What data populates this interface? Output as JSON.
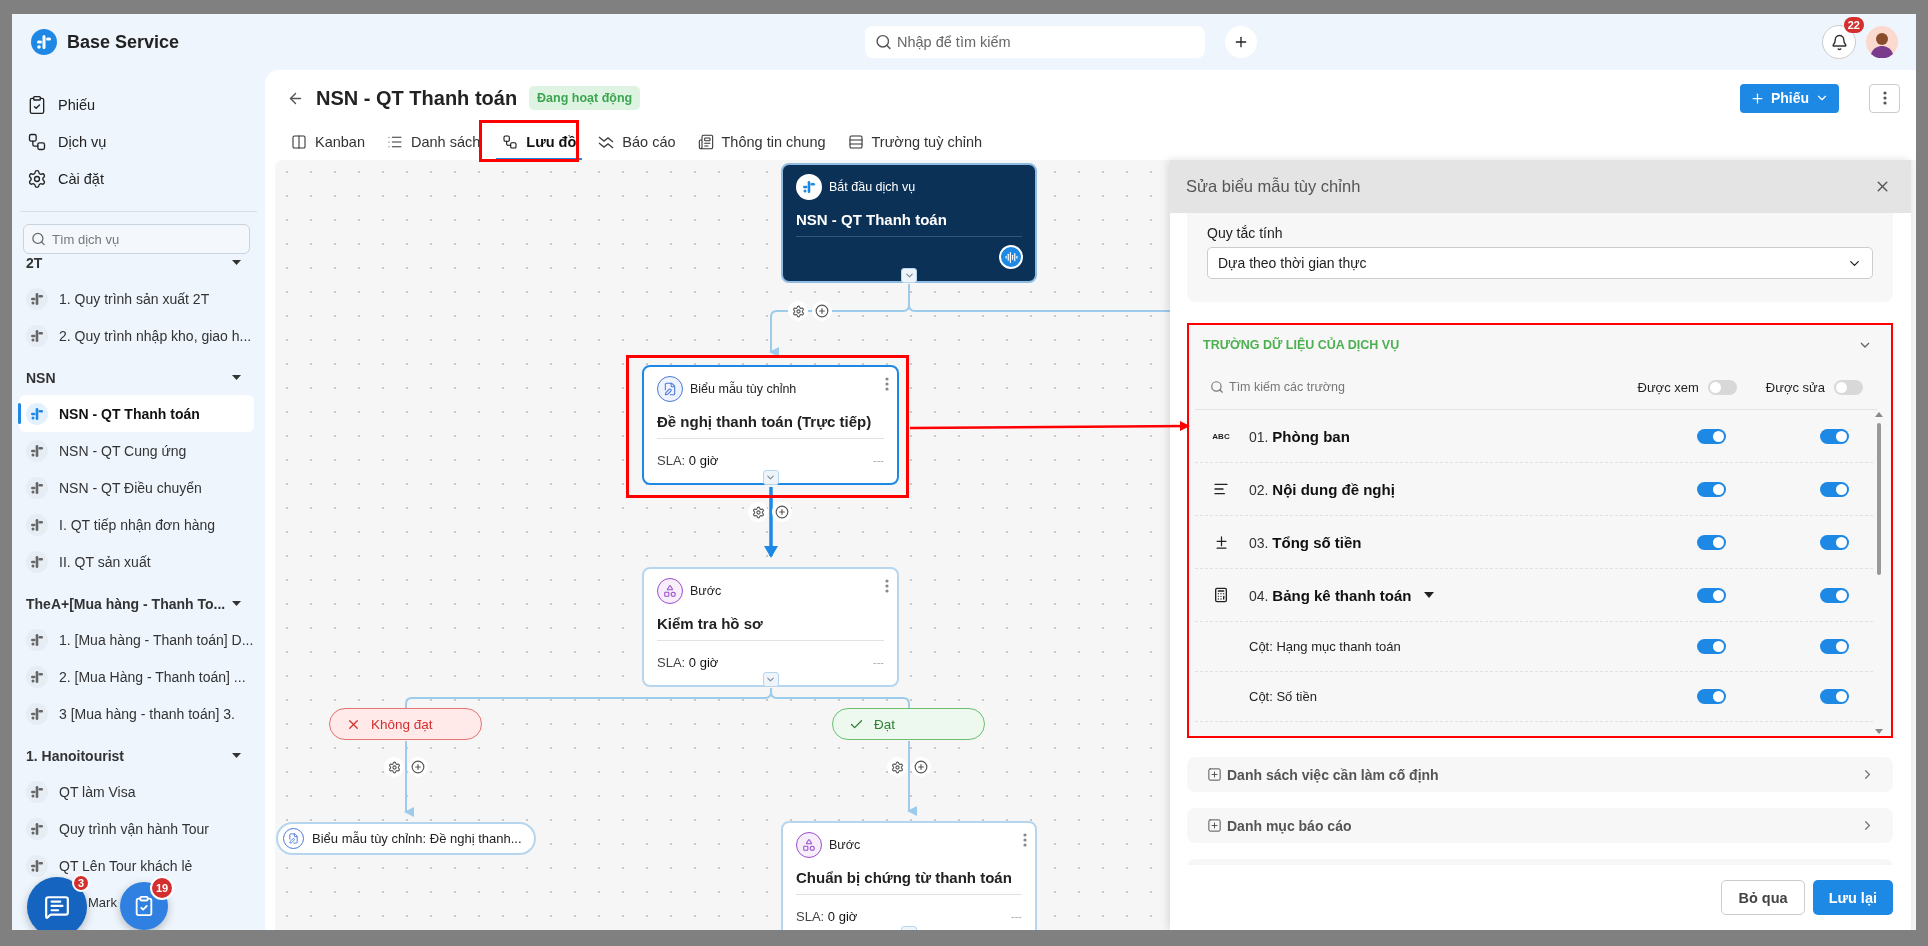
{
  "app": {
    "name": "Base Service"
  },
  "nav": [
    {
      "label": "Phiếu",
      "kind": "tickets"
    },
    {
      "label": "Dịch vụ",
      "kind": "services"
    },
    {
      "label": "Cài đặt",
      "kind": "settings"
    }
  ],
  "service_search": {
    "placeholder": "Tìm dịch vụ"
  },
  "groups": [
    {
      "title": "2T",
      "expanded": true,
      "items": [
        {
          "label": "1. Quy trình sản xuất 2T",
          "selected": false
        },
        {
          "label": "2. Quy trình nhập kho, giao h...",
          "selected": false
        }
      ]
    },
    {
      "title": "NSN",
      "expanded": true,
      "items": [
        {
          "label": "NSN - QT Thanh toán",
          "selected": true
        },
        {
          "label": "NSN - QT Cung ứng",
          "selected": false
        },
        {
          "label": "NSN - QT Điều chuyển",
          "selected": false
        },
        {
          "label": "I. QT tiếp nhận đơn hàng",
          "selected": false
        },
        {
          "label": "II. QT sản xuất",
          "selected": false
        }
      ]
    },
    {
      "title": "TheA+[Mua hàng - Thanh To...",
      "expanded": true,
      "items": [
        {
          "label": "1. [Mua hàng - Thanh toán] D...",
          "selected": false
        },
        {
          "label": "2. [Mua Hàng - Thanh toán] ...",
          "selected": false
        },
        {
          "label": "3 [Mua hàng - thanh toán] 3.",
          "selected": false
        }
      ]
    },
    {
      "title": "1. Hanoitourist",
      "expanded": true,
      "items": [
        {
          "label": "QT làm Visa",
          "selected": false
        },
        {
          "label": "Quy trình vận hành Tour",
          "selected": false
        },
        {
          "label": "QT Lên Tour khách lẻ",
          "selected": false
        },
        {
          "label": "Mark",
          "selected": false,
          "covered": true
        }
      ]
    }
  ],
  "floating": [
    {
      "kind": "chat",
      "count": "3"
    },
    {
      "kind": "tasks",
      "count": "19"
    }
  ],
  "search": {
    "placeholder": "Nhập để tìm kiếm"
  },
  "notifications": {
    "count": "22"
  },
  "page": {
    "title": "NSN - QT Thanh toán",
    "status": "Đang hoạt động",
    "new_button": "Phiếu"
  },
  "tabs": [
    {
      "label": "Kanban",
      "kind": "kanban",
      "selected": false
    },
    {
      "label": "Danh sách",
      "kind": "list",
      "selected": false
    },
    {
      "label": "Lưu đồ",
      "kind": "flow",
      "selected": true
    },
    {
      "label": "Báo cáo",
      "kind": "report",
      "selected": false
    },
    {
      "label": "Thông tin chung",
      "kind": "info",
      "selected": false
    },
    {
      "label": "Trường tuỳ chỉnh",
      "kind": "fields",
      "selected": false
    }
  ],
  "flow": {
    "nodes": [
      {
        "kind": "start",
        "type_label": "Bắt đầu dịch vụ",
        "title": "NSN - QT Thanh toán"
      },
      {
        "kind": "form",
        "type_label": "Biểu mẫu tùy chỉnh",
        "title": "Đề nghị thanh toán (Trực tiếp)",
        "sla_label": "SLA:",
        "sla_value": "0 giờ",
        "extra": "---",
        "selected": true
      },
      {
        "kind": "step",
        "type_label": "Bước",
        "title": "Kiểm tra hồ sơ",
        "sla_label": "SLA:",
        "sla_value": "0 giờ",
        "extra": "---",
        "selected": false
      },
      {
        "kind": "step",
        "type_label": "Bước",
        "title": "Chuẩn bị chứng từ thanh toán",
        "sla_label": "SLA:",
        "sla_value": "0 giờ",
        "extra": "---",
        "selected": false
      }
    ],
    "branches": [
      {
        "kind": "fail",
        "label": "Không đạt"
      },
      {
        "kind": "pass",
        "label": "Đạt"
      }
    ],
    "link_node": {
      "label": "Biểu mẫu tùy chỉnh: Đề nghị thanh..."
    }
  },
  "panel": {
    "title": "Sửa biểu mẫu tùy chỉnh",
    "rule": {
      "label": "Quy tắc tính",
      "value": "Dựa theo thời gian thực"
    },
    "fields_section": {
      "title": "TRƯỜNG DỮ LIỆU CỦA DỊCH VỤ",
      "expanded": true,
      "search_placeholder": "Tìm kiếm các trường",
      "view_all": {
        "label": "Được xem",
        "on": false
      },
      "edit_all": {
        "label": "Được sửa",
        "on": false
      },
      "fields": [
        {
          "kind": "text",
          "type_mark": "ABC",
          "number": "01.",
          "name": "Phòng ban",
          "view": true,
          "edit": true
        },
        {
          "kind": "paragraph",
          "number": "02.",
          "name": "Nội dung đề nghị",
          "view": true,
          "edit": true
        },
        {
          "kind": "number",
          "number": "03.",
          "name": "Tổng số tiền",
          "view": true,
          "edit": true
        },
        {
          "kind": "table",
          "number": "04.",
          "name": "Bảng kê thanh toán",
          "view": true,
          "edit": true,
          "expanded": true,
          "children": [
            {
              "label": "Cột: Hạng mục thanh toán",
              "view": true,
              "edit": true
            },
            {
              "label": "Cột: Số tiền",
              "view": true,
              "edit": true
            }
          ]
        }
      ]
    },
    "sections": [
      {
        "label": "Danh sách việc cần làm cố định"
      },
      {
        "label": "Danh mục báo cáo"
      }
    ],
    "buttons": {
      "cancel": "Bỏ qua",
      "save": "Lưu lại"
    }
  }
}
